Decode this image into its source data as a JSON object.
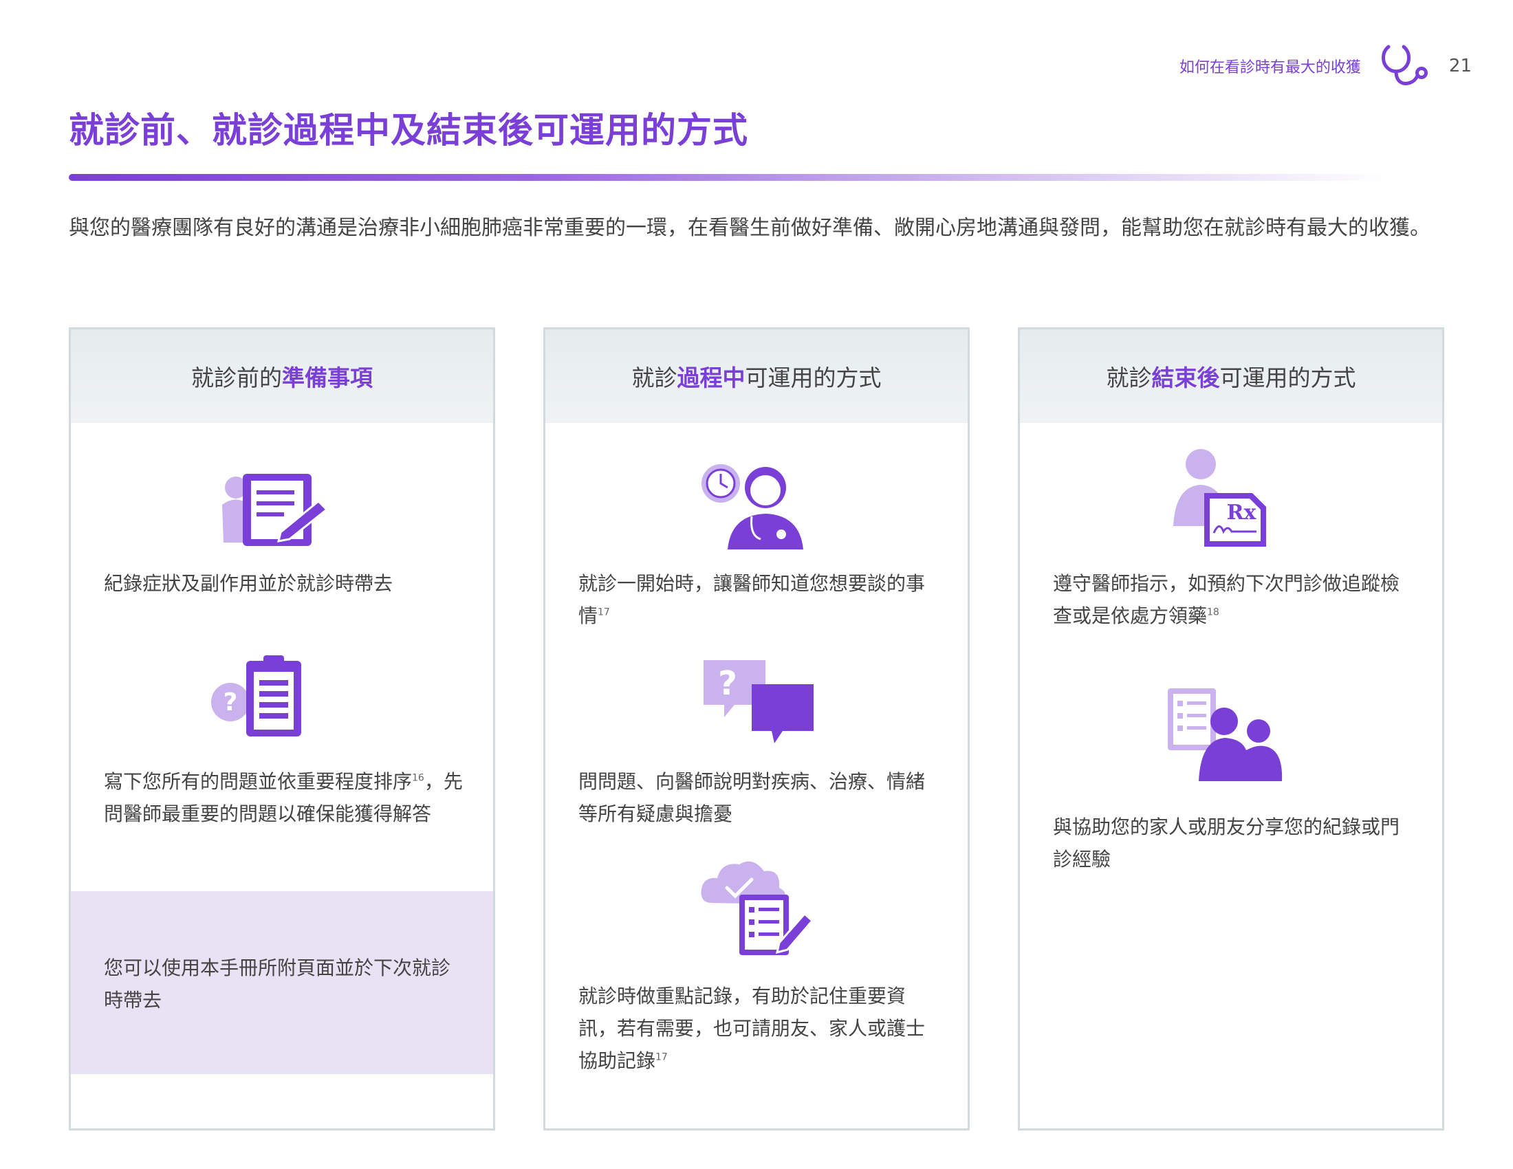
{
  "header": {
    "section_label": "如何在看診時有最大的收獲",
    "page_number": "21",
    "icon": "stethoscope-icon"
  },
  "title": "就診前、就診過程中及結束後可運用的方式",
  "intro": "與您的醫療團隊有良好的溝通是治療非小細胞肺癌非常重要的一環，在看醫生前做好準備、敞開心房地溝通與發問，能幫助您在就診時有最大的收獲。",
  "colors": {
    "accent": "#7a3fd6",
    "accent_light": "#c9b2ee",
    "header_bg": "#e9eef0",
    "tip_bg": "#e9e1f4",
    "border": "#d3dade"
  },
  "cards": [
    {
      "heading_pre": "就診前的",
      "heading_highlight": "準備事項",
      "heading_post": "",
      "items": [
        {
          "icon": "notes-writing-icon",
          "text": "紀錄症狀及副作用並於就診時帶去",
          "sup": ""
        },
        {
          "icon": "question-clipboard-icon",
          "text": "寫下您所有的問題並依重要程度排序",
          "sup": "16",
          "text_after": "，先問醫師最重要的問題以確保能獲得解答"
        }
      ],
      "tip": "您可以使用本手冊所附頁面並於下次就診時帶去"
    },
    {
      "heading_pre": "就診",
      "heading_highlight": "過程中",
      "heading_post": "可運用的方式",
      "items": [
        {
          "icon": "doctor-clock-icon",
          "text": "就診一開始時，讓醫師知道您想要談的事情",
          "sup": "17"
        },
        {
          "icon": "question-chat-icon",
          "text": "問問題、向醫師說明對疾病、治療、情緒等所有疑慮與擔憂",
          "sup": ""
        },
        {
          "icon": "cloud-checklist-icon",
          "text": "就診時做重點記錄，有助於記住重要資訊，若有需要，也可請朋友、家人或護士協助記錄",
          "sup": "17"
        }
      ]
    },
    {
      "heading_pre": "就診",
      "heading_highlight": "結束後",
      "heading_post": "可運用的方式",
      "items": [
        {
          "icon": "doctor-prescription-icon",
          "text": "遵守醫師指示，如預約下次門診做追蹤檢查或是依處方領藥",
          "sup": "18"
        },
        {
          "icon": "family-share-icon",
          "text": "與協助您的家人或朋友分享您的紀錄或門診經驗",
          "sup": ""
        }
      ]
    }
  ]
}
